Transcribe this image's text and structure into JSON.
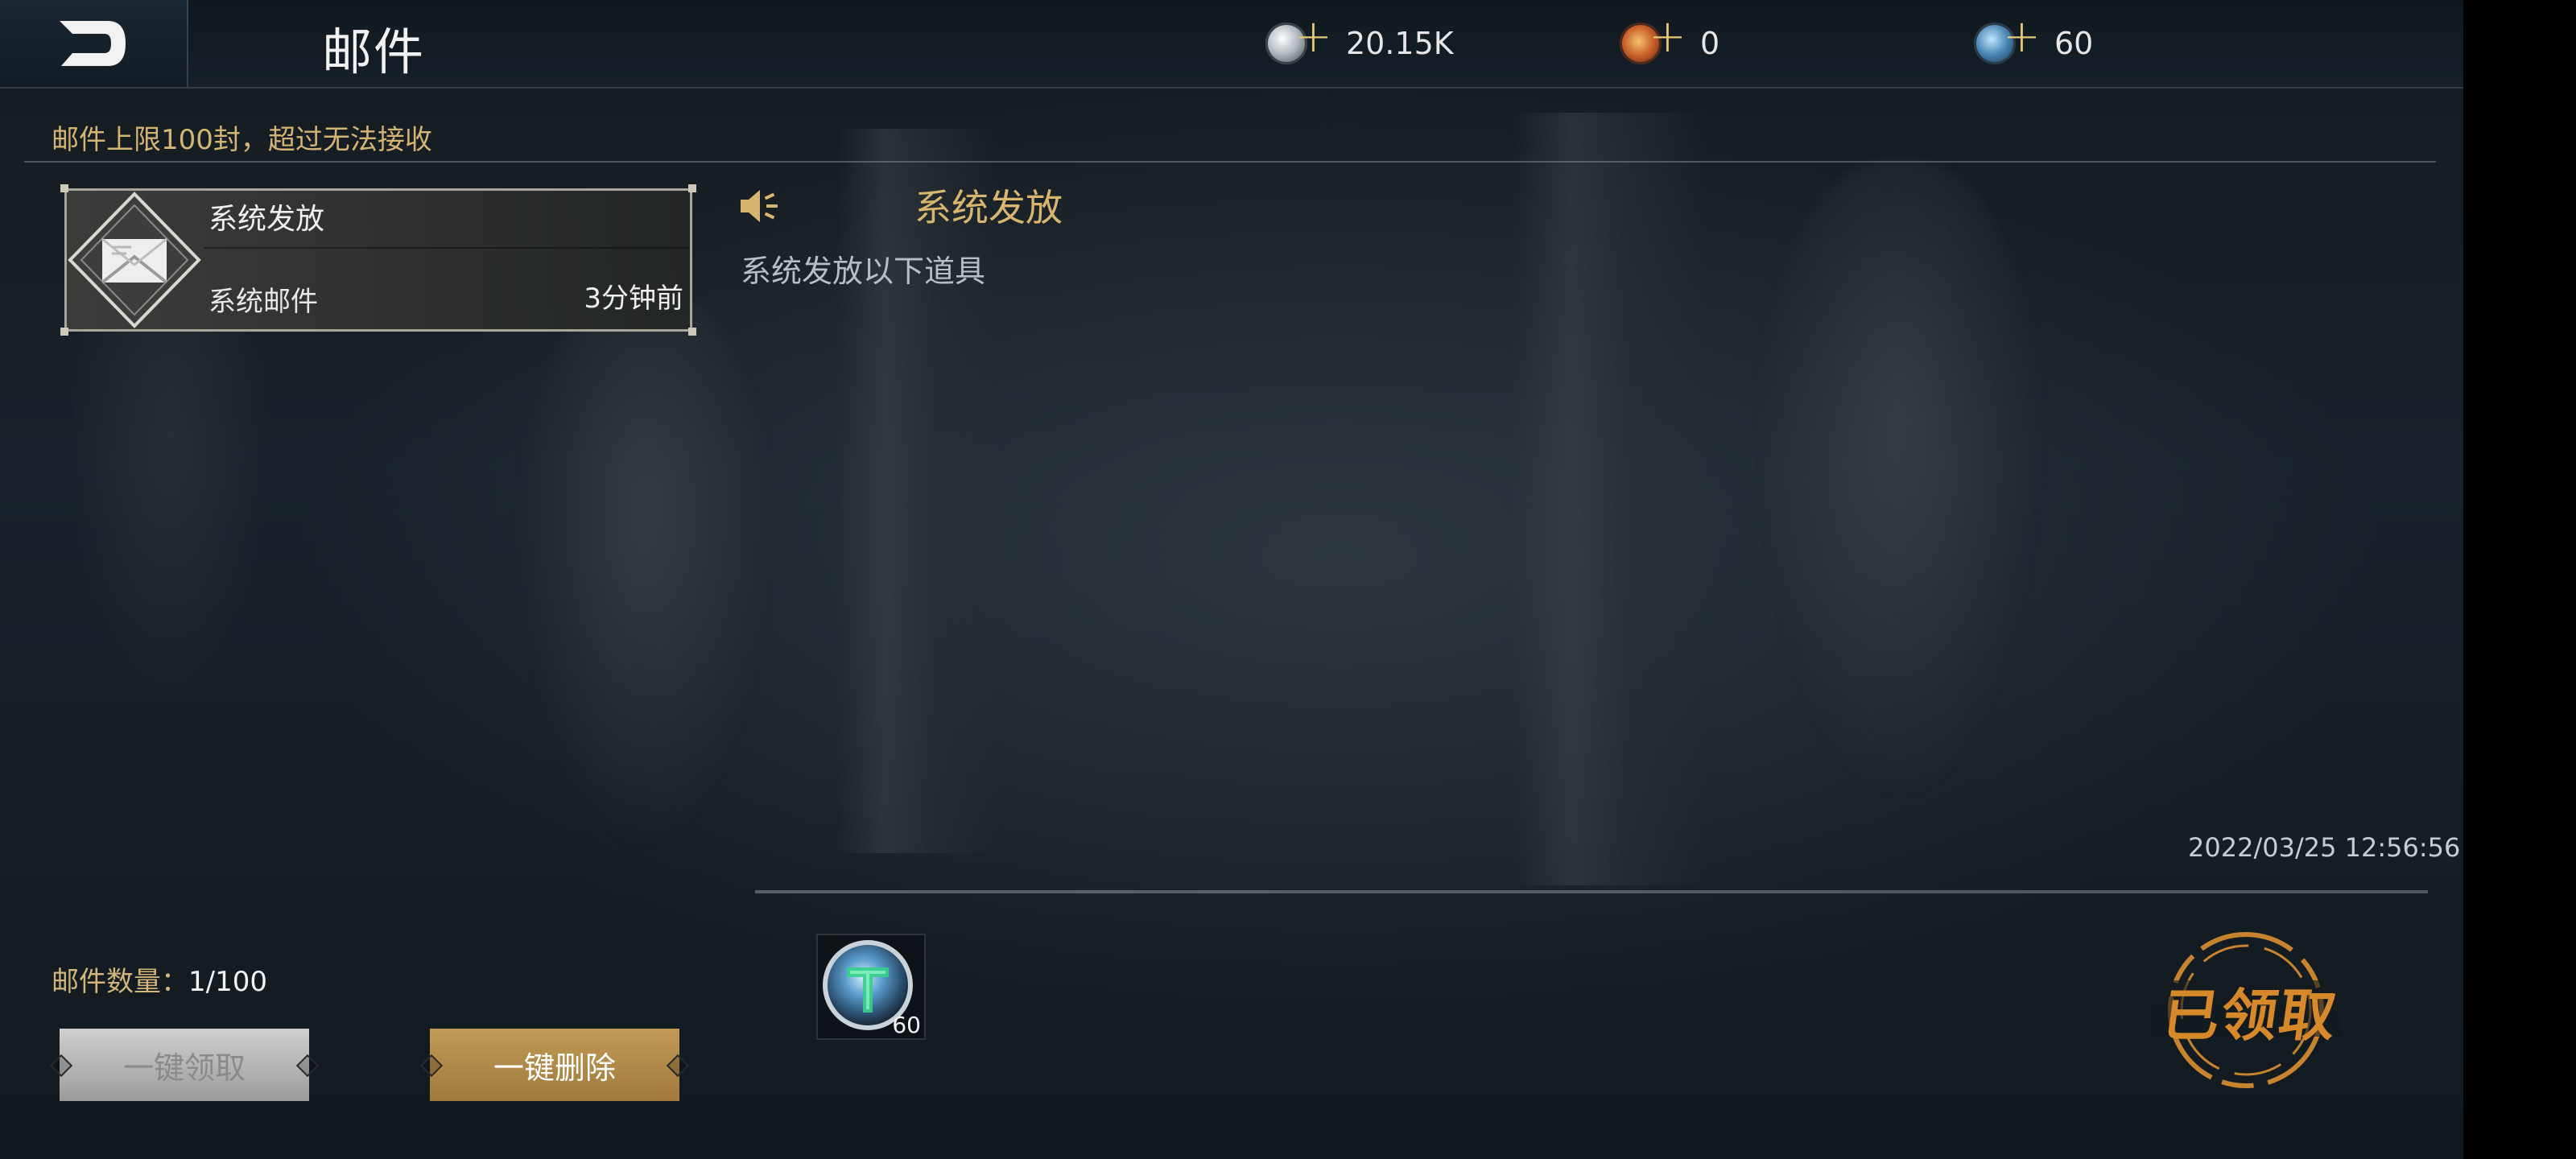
{
  "app": {
    "title": "邮件",
    "back_icon": "back-arrow-icon"
  },
  "currencies": [
    {
      "icon": "silver-coin-icon",
      "value": "20.15K",
      "color": "#bfc6cc"
    },
    {
      "icon": "red-gem-coin-icon",
      "value": "0",
      "color": "#c9602a"
    },
    {
      "icon": "blue-crystal-coin-icon",
      "value": "60",
      "color": "#4a86b5"
    }
  ],
  "notice": {
    "text": "邮件上限100封，超过无法接收"
  },
  "mail_list": [
    {
      "title": "系统发放",
      "subtitle": "系统邮件",
      "time": "3分钟前",
      "icon": "envelope-icon",
      "selected": true
    }
  ],
  "detail": {
    "speaker_icon": "speaker-icon",
    "title": "系统发放",
    "body": "系统发放以下道具",
    "date": "2022/03/25 12:56:56",
    "rewards": [
      {
        "icon": "blue-crystal-coin-icon",
        "count": "60"
      }
    ],
    "status": "已领取"
  },
  "footer": {
    "count_label": "邮件数量：",
    "count_value": "1/100",
    "claim_all_label": "一键领取",
    "claim_all_enabled": false,
    "delete_all_label": "一键删除"
  },
  "colors": {
    "gold": "#d4b574",
    "accent_orange": "#d6882a",
    "text_light": "#f0f0f0"
  }
}
